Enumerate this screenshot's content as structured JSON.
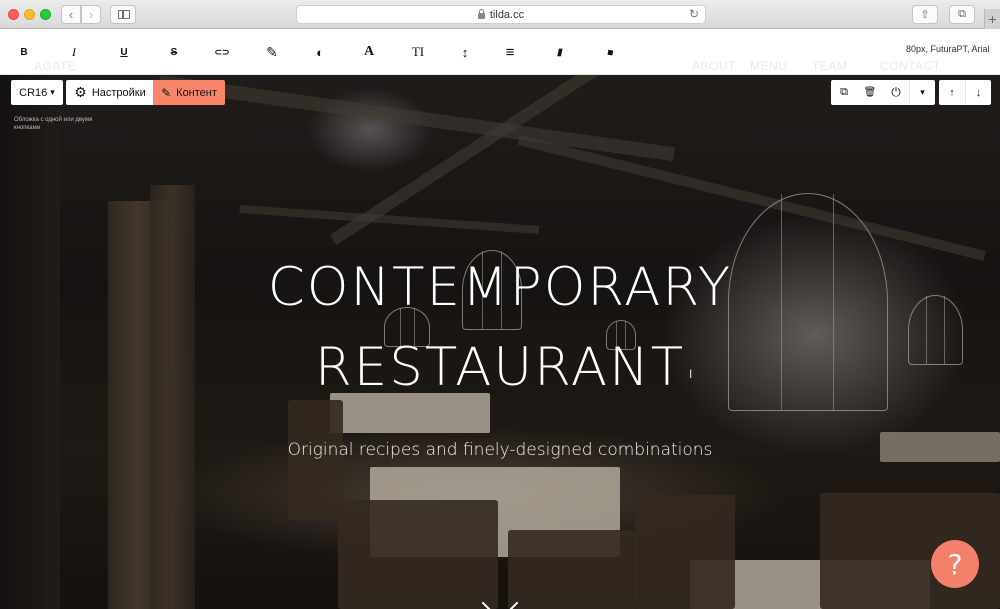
{
  "browser": {
    "url": "tilda.cc",
    "back_glyph": "‹",
    "forward_glyph": "›",
    "reload_glyph": "↻",
    "share_glyph": "⇧",
    "tabs_glyph": "⧉",
    "newtab_glyph": "+"
  },
  "format_toolbar": {
    "bold": "B",
    "italic": "I",
    "underline": "U",
    "strike": "S",
    "link_glyph": "⊂⊃",
    "brush_glyph": "✎",
    "contrast_glyph": "◐",
    "font_glyph": "A",
    "size_glyph": "TI",
    "line_height_glyph": "↕",
    "align_glyph": "≡",
    "book_glyph": "▮",
    "eraser_glyph": "◆",
    "font_info": "80px, FuturaPT, Arial",
    "ghost_menu": [
      "AGATE",
      "ABOUT",
      "MENU",
      "TEAM",
      "CONTACT"
    ]
  },
  "block_controls": {
    "code_label": "CR16",
    "code_caret": "▾",
    "settings_glyph": "⚙",
    "settings_label": "Настройки",
    "content_glyph": "✎",
    "content_label": "Контент",
    "block_description": "Обложка с одной или двумя кнопками",
    "duplicate_glyph": "⧉",
    "delete_glyph": "🗑",
    "power_glyph": "⏻",
    "more_glyph": "▾",
    "move_up_glyph": "↑",
    "move_down_glyph": "↓"
  },
  "hero": {
    "title_line1": "CONTEMPORARY",
    "title_line2": "RESTAURANT",
    "subtitle": "Original recipes and finely-designed combinations",
    "cursor_glyph": "I"
  },
  "help": {
    "label": "?"
  },
  "colors": {
    "accent": "#fa8669",
    "help": "#f3806b"
  }
}
